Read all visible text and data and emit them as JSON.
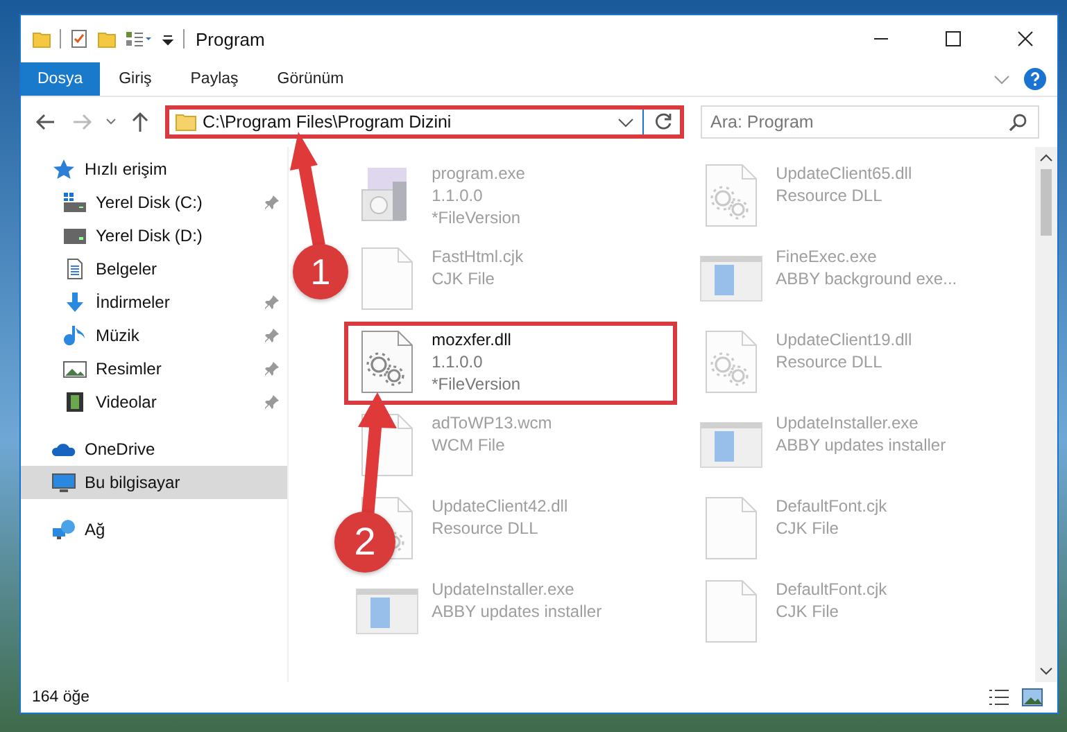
{
  "window": {
    "title": "Program"
  },
  "ribbon_tabs": [
    {
      "label": "Dosya",
      "selected": true
    },
    {
      "label": "Giriş",
      "selected": false
    },
    {
      "label": "Paylaş",
      "selected": false
    },
    {
      "label": "Görünüm",
      "selected": false
    }
  ],
  "address_bar": {
    "path": "C:\\Program Files\\Program Dizini",
    "highlighted": true
  },
  "search": {
    "placeholder": "Ara: Program"
  },
  "sidebar": {
    "items": [
      {
        "label": "Hızlı erişim",
        "kind": "star",
        "pinned": false,
        "selected": false,
        "sub": false
      },
      {
        "label": "Yerel Disk (C:)",
        "kind": "disk-c",
        "pinned": true,
        "selected": false,
        "sub": true
      },
      {
        "label": "Yerel Disk (D:)",
        "kind": "disk",
        "pinned": false,
        "selected": false,
        "sub": true
      },
      {
        "label": "Belgeler",
        "kind": "doc",
        "pinned": false,
        "selected": false,
        "sub": true
      },
      {
        "label": "İndirmeler",
        "kind": "download",
        "pinned": true,
        "selected": false,
        "sub": true
      },
      {
        "label": "Müzik",
        "kind": "music",
        "pinned": true,
        "selected": false,
        "sub": true
      },
      {
        "label": "Resimler",
        "kind": "pictures",
        "pinned": true,
        "selected": false,
        "sub": true
      },
      {
        "label": "Videolar",
        "kind": "video",
        "pinned": true,
        "selected": false,
        "sub": true
      },
      {
        "label": "OneDrive",
        "kind": "cloud",
        "pinned": false,
        "selected": false,
        "sub": false
      },
      {
        "label": "Bu bilgisayar",
        "kind": "pc",
        "pinned": false,
        "selected": true,
        "sub": false
      },
      {
        "label": "Ağ",
        "kind": "network",
        "pinned": false,
        "selected": false,
        "sub": false
      }
    ]
  },
  "files": [
    {
      "kind": "program",
      "lines": [
        "program.exe",
        "1.1.0.0",
        "*FileVersion"
      ],
      "highlighted": false
    },
    {
      "kind": "dll",
      "lines": [
        "UpdateClient65.dll",
        "Resource DLL"
      ],
      "highlighted": false
    },
    {
      "kind": "blank",
      "lines": [
        "FastHtml.cjk",
        "CJK File"
      ],
      "highlighted": false
    },
    {
      "kind": "app",
      "lines": [
        "FineExec.exe",
        "ABBY background exe..."
      ],
      "highlighted": false
    },
    {
      "kind": "dll",
      "lines": [
        "mozxfer.dll",
        "1.1.0.0",
        "*FileVersion"
      ],
      "highlighted": true
    },
    {
      "kind": "dll",
      "lines": [
        "UpdateClient19.dll",
        "Resource DLL"
      ],
      "highlighted": false
    },
    {
      "kind": "blank",
      "lines": [
        "adToWP13.wcm",
        "WCM File"
      ],
      "highlighted": false
    },
    {
      "kind": "app",
      "lines": [
        "UpdateInstaller.exe",
        "ABBY updates installer"
      ],
      "highlighted": false
    },
    {
      "kind": "dll",
      "lines": [
        "UpdateClient42.dll",
        "Resource DLL"
      ],
      "highlighted": false
    },
    {
      "kind": "blank",
      "lines": [
        "DefaultFont.cjk",
        "CJK File"
      ],
      "highlighted": false
    },
    {
      "kind": "app",
      "lines": [
        "UpdateInstaller.exe",
        "ABBY updates installer"
      ],
      "highlighted": false
    },
    {
      "kind": "blank",
      "lines": [
        "DefaultFont.cjk",
        "CJK File"
      ],
      "highlighted": false
    }
  ],
  "status_bar": {
    "count": "164 öğe"
  },
  "steps": [
    {
      "number": "1"
    },
    {
      "number": "2"
    }
  ]
}
